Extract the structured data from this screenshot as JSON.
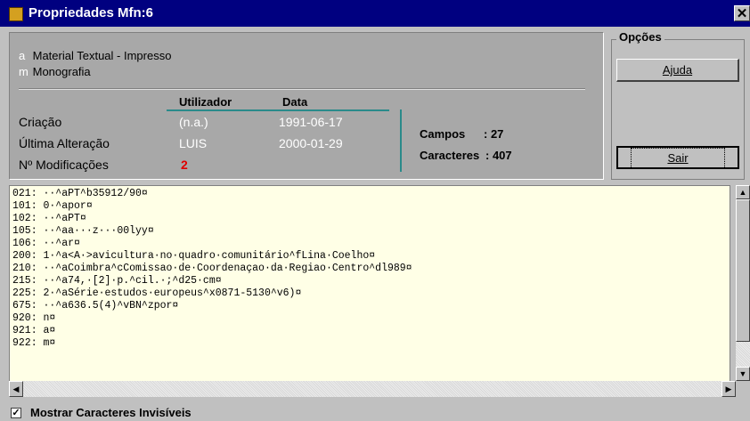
{
  "window": {
    "title": "Propriedades  Mfn:6",
    "close_symbol": "✕"
  },
  "record": {
    "types": [
      {
        "code": "a",
        "label": "Material Textual - Impresso"
      },
      {
        "code": "m",
        "label": "Monografia"
      }
    ],
    "columns": {
      "user": "Utilizador",
      "date": "Data"
    },
    "rows": [
      {
        "label": "Criação",
        "user": "(n.a.)",
        "date": "1991-06-17"
      },
      {
        "label": "Última Alteração",
        "user": "LUIS",
        "date": "2000-01-29"
      },
      {
        "label": "Nº Modificações",
        "count": "2"
      }
    ],
    "stats": {
      "fields_label": "Campos",
      "fields_value": ": 27",
      "chars_label": "Caracteres",
      "chars_value": ": 407"
    }
  },
  "options": {
    "title": "Opções",
    "help_button": "Ajuda",
    "exit_button": "Sair"
  },
  "editor_lines": [
    "021: ··^aPT^b35912/90¤",
    "101: 0·^apor¤",
    "102: ··^aPT¤",
    "105: ··^aa···z···00lyy¤",
    "106: ··^ar¤",
    "200: 1·^a<A·>avicultura·no·quadro·comunitário^fLina·Coelho¤",
    "210: ··^aCoimbra^cComissao·de·Coordenaçao·da·Regiao·Centro^dl989¤",
    "215: ··^a74,·[2]·p.^cil.·;^d25·cm¤",
    "225: 2·^aSérie·estudos·europeus^x0871-5130^v6)¤",
    "675: ··^a636.5(4)^vBN^zpor¤",
    "920: n¤",
    "921: a¤",
    "922: m¤"
  ],
  "footer": {
    "show_invisible_label": "Mostrar Caracteres Invisíveis",
    "checked": true
  }
}
